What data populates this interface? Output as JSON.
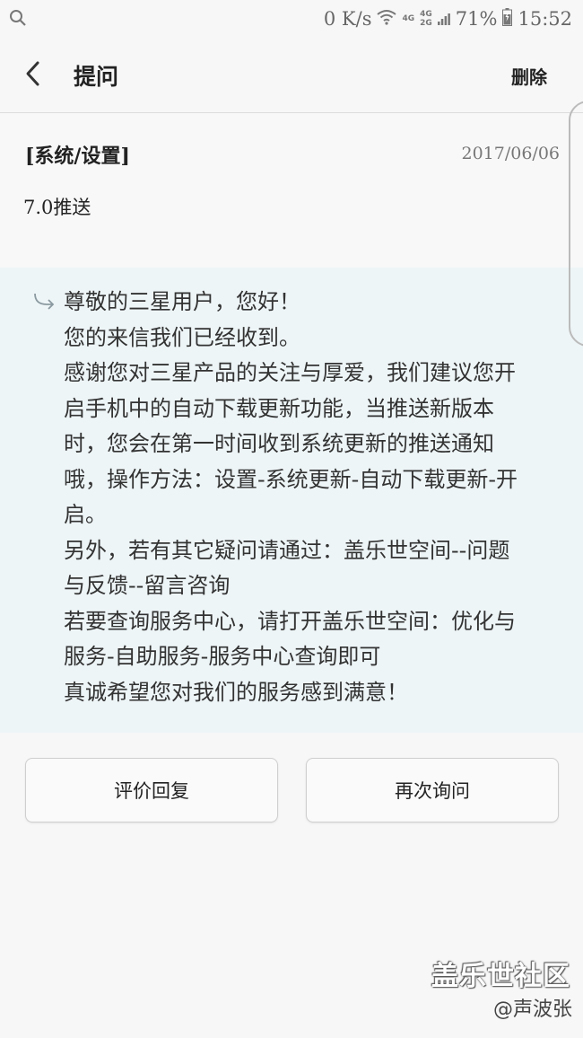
{
  "status_bar": {
    "speed": "0 K/s",
    "network_labels": [
      "4G",
      "4G",
      "2G"
    ],
    "battery": "71%",
    "time": "15:52"
  },
  "app_bar": {
    "title": "提问",
    "delete_label": "删除"
  },
  "question": {
    "category": "[系统/设置]",
    "date": "2017/06/06",
    "text": "7.0推送"
  },
  "reply": {
    "lines": [
      "尊敬的三星用户，您好！",
      "您的来信我们已经收到。",
      "感谢您对三星产品的关注与厚爱，我们建议您开",
      "启手机中的自动下载更新功能，当推送新版本",
      "时，您会在第一时间收到系统更新的推送通知",
      "哦，操作方法：设置-系统更新-自动下载更新-开",
      "启。",
      "另外，若有其它疑问请通过：盖乐世空间--问题",
      "与反馈--留言咨询",
      "若要查询服务中心，请打开盖乐世空间：优化与",
      "服务-自助服务-服务中心查询即可",
      "真诚希望您对我们的服务感到满意！"
    ]
  },
  "buttons": {
    "rate_label": "评价回复",
    "ask_again_label": "再次询问"
  },
  "watermark": {
    "brand": "盖乐世社区",
    "author": "@声波张"
  },
  "icons": {
    "search": "search-icon",
    "wifi": "wifi-icon",
    "signal": "signal-icon",
    "battery": "battery-icon",
    "back": "back-arrow-icon",
    "reply": "reply-arrow-icon"
  },
  "colors": {
    "reply_background": "#eef5f7",
    "page_background": "#f7f7f7"
  }
}
